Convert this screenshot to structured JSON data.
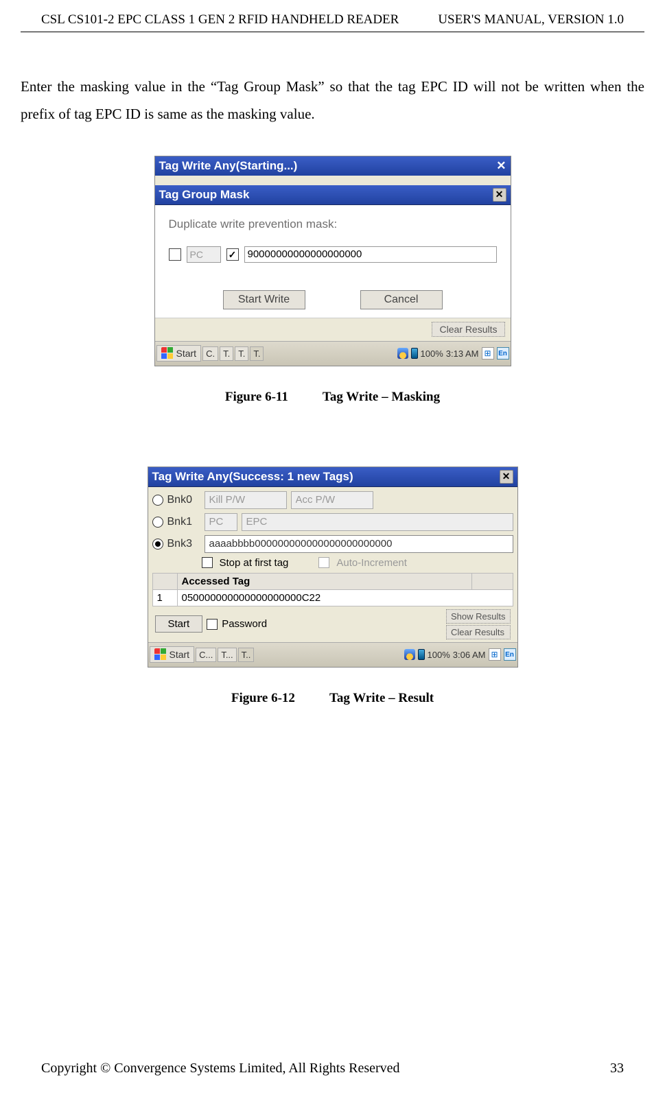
{
  "header": {
    "left": "CSL CS101-2 EPC CLASS 1 GEN 2 RFID HANDHELD READER",
    "right": "USER'S  MANUAL,  VERSION  1.0"
  },
  "paragraph": "Enter the masking value in the “Tag Group Mask” so that the tag EPC ID will not be written when the prefix of tag EPC ID is same as the masking value.",
  "fig1": {
    "outerTitle": "Tag Write Any(Starting...)",
    "innerTitle": "Tag Group Mask",
    "prompt": "Duplicate write prevention mask:",
    "pcLabel": "PC",
    "maskValue": "90000000000000000000",
    "startBtn": "Start Write",
    "cancelBtn": "Cancel",
    "clearBtn": "Clear Results",
    "taskbar": {
      "start": "Start",
      "btns": [
        "C.",
        "T.",
        "T.",
        "T."
      ],
      "battery": "100%",
      "time": "3:13 AM",
      "en": "En"
    },
    "caption_no": "Figure 6-11",
    "caption_txt": "Tag Write – Masking"
  },
  "fig2": {
    "title": "Tag Write Any(Success: 1 new Tags)",
    "bnk0": "Bnk0",
    "bnk1": "Bnk1",
    "bnk3": "Bnk3",
    "killpw": "Kill P/W",
    "accpw": "Acc P/W",
    "pc": "PC",
    "epc": "EPC",
    "bnk3val": "aaaabbbb000000000000000000000000",
    "stopFirst": "Stop at first tag",
    "autoInc": "Auto-Increment",
    "tableHeader": "Accessed Tag",
    "rowIdx": "1",
    "rowVal": "050000000000000000000C22",
    "startBtn": "Start",
    "pwLabel": "Password",
    "showBtn": "Show Results",
    "clearBtn": "Clear Results",
    "taskbar": {
      "start": "Start",
      "btns": [
        "C...",
        "T...",
        "T.."
      ],
      "battery": "100%",
      "time": "3:06 AM",
      "en": "En"
    },
    "caption_no": "Figure 6-12",
    "caption_txt": "Tag Write – Result"
  },
  "footer": {
    "left": "Copyright © Convergence Systems Limited, All Rights Reserved",
    "right": "33"
  }
}
